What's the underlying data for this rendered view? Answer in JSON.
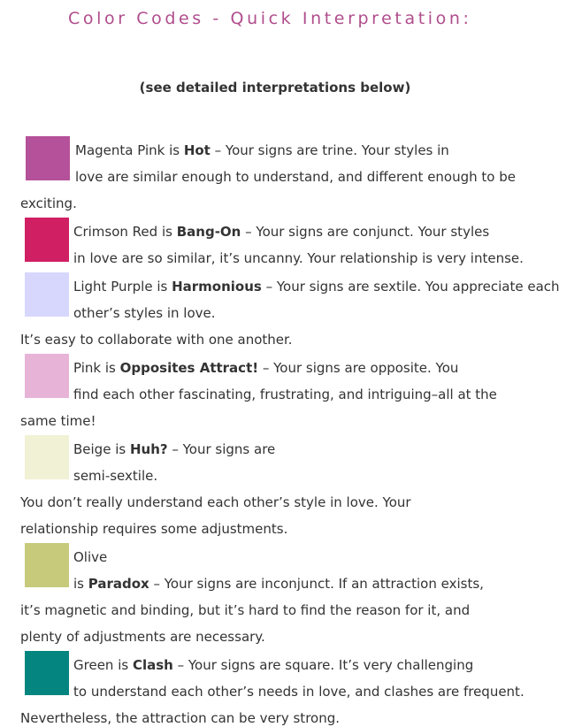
{
  "header": {
    "title": "Color Codes - Quick Interpretation:",
    "subtitle": "(see detailed interpretations below)"
  },
  "entries": [
    {
      "color": "#b5519a",
      "swatch_icon": "color-swatch",
      "name_prefix": "Magenta Pink is ",
      "keyword": "Hot",
      "line1_rest": " – Your signs are trine. Your styles in",
      "line2": "love are similar enough to understand, and different enough to be",
      "line3": "exciting."
    },
    {
      "color": "#d01f63",
      "swatch_icon": "color-swatch",
      "name_prefix": "Crimson Red is ",
      "keyword": "Bang-On",
      "line1_rest": " – Your signs are conjunct. Your styles",
      "line2": "in love are so similar, it’s uncanny. Your relationship is very intense."
    },
    {
      "color": "#d7d7fd",
      "swatch_icon": "color-swatch",
      "name_prefix": "Light Purple is ",
      "keyword": "Harmonious",
      "line1_rest": " – Your signs are sextile. You appreciate each",
      "line2": "other’s styles in love.",
      "line3": "It’s easy to collaborate with one another."
    },
    {
      "color": "#e7b4d7",
      "swatch_icon": "color-swatch",
      "name_prefix": "Pink is ",
      "keyword": "Opposites Attract!",
      "line1_rest": " – Your signs are opposite. You",
      "line2": "find each other fascinating, frustrating, and intriguing–all at the",
      "line3": "same time!"
    },
    {
      "color": "#f1f1d5",
      "swatch_icon": "color-swatch",
      "name_prefix": "Beige is ",
      "keyword": "Huh?",
      "line1_rest": " – Your signs are",
      "line2": "semi-sextile.",
      "line3": "You don’t really understand each other’s style in love. Your",
      "line4": "relationship requires some adjustments."
    },
    {
      "color": "#c7c97b",
      "swatch_icon": "color-swatch",
      "line1": "Olive",
      "line2_prefix": "is ",
      "keyword": "Paradox",
      "line2_rest": " – Your signs are inconjunct. If an attraction exists,",
      "line3": "it’s magnetic and binding, but it’s hard to find the reason for it, and",
      "line4": "plenty of adjustments are necessary."
    },
    {
      "color": "#058580",
      "swatch_icon": "color-swatch",
      "name_prefix": "Green is ",
      "keyword": "Clash",
      "line1_rest": " – Your signs are square. It’s very challenging",
      "line2": "to understand each other’s needs in love, and clashes are frequent.",
      "line3": "Nevertheless, the attraction can be very strong."
    }
  ]
}
